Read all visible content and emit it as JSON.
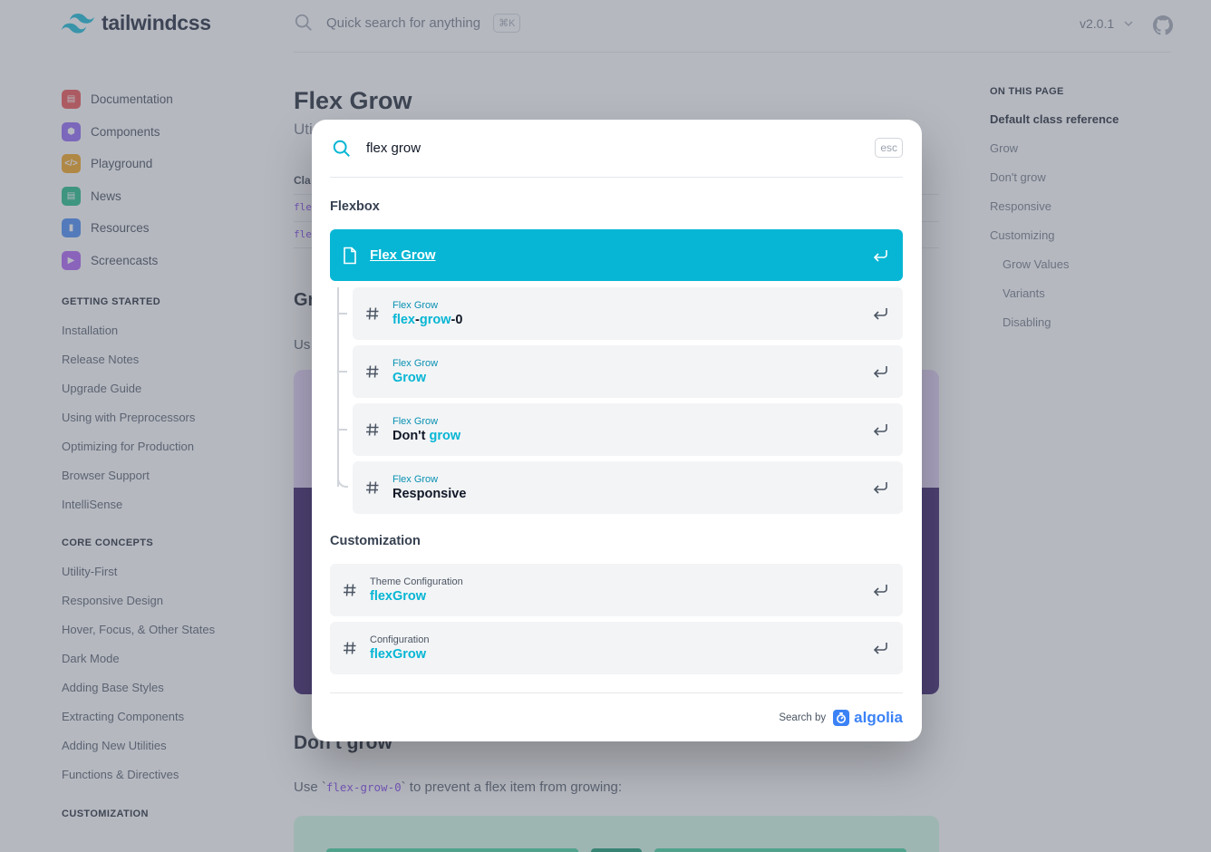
{
  "header": {
    "logo_text": "tailwindcss",
    "search_placeholder": "Quick search for anything",
    "search_shortcut": "⌘K",
    "version": "v2.0.1"
  },
  "sidebar": {
    "main_items": [
      {
        "label": "Documentation",
        "color": "#ef4444",
        "glyph": "▤"
      },
      {
        "label": "Components",
        "color": "#8b5cf6",
        "glyph": "⬢"
      },
      {
        "label": "Playground",
        "color": "#f59e0b",
        "glyph": "</>"
      },
      {
        "label": "News",
        "color": "#10b981",
        "glyph": "▤"
      },
      {
        "label": "Resources",
        "color": "#3b82f6",
        "glyph": "▮"
      },
      {
        "label": "Screencasts",
        "color": "#a855f7",
        "glyph": "▶"
      }
    ],
    "getting_started_heading": "GETTING STARTED",
    "getting_started": [
      "Installation",
      "Release Notes",
      "Upgrade Guide",
      "Using with Preprocessors",
      "Optimizing for Production",
      "Browser Support",
      "IntelliSense"
    ],
    "core_concepts_heading": "CORE CONCEPTS",
    "core_concepts": [
      "Utility-First",
      "Responsive Design",
      "Hover, Focus, & Other States",
      "Dark Mode",
      "Adding Base Styles",
      "Extracting Components",
      "Adding New Utilities",
      "Functions & Directives"
    ],
    "customization_heading": "CUSTOMIZATION"
  },
  "content": {
    "title": "Flex Grow",
    "lead": "Uti",
    "table_header": "Cla",
    "row1": "fle",
    "row2": "fle",
    "section_grow": "Gr",
    "section_grow_text": "Us",
    "section_dont_grow": "Don't grow",
    "dont_grow_text_before": "Use `",
    "dont_grow_code": "flex-grow-0",
    "dont_grow_text_after": "` to prevent a flex item from growing:"
  },
  "toc": {
    "heading": "ON THIS PAGE",
    "items": [
      {
        "label": "Default class reference",
        "active": true,
        "sub": false
      },
      {
        "label": "Grow",
        "active": false,
        "sub": false
      },
      {
        "label": "Don't grow",
        "active": false,
        "sub": false
      },
      {
        "label": "Responsive",
        "active": false,
        "sub": false
      },
      {
        "label": "Customizing",
        "active": false,
        "sub": false
      },
      {
        "label": "Grow Values",
        "active": false,
        "sub": true
      },
      {
        "label": "Variants",
        "active": false,
        "sub": true
      },
      {
        "label": "Disabling",
        "active": false,
        "sub": true
      }
    ]
  },
  "search_modal": {
    "query": "flex grow",
    "esc_label": "esc",
    "groups": [
      {
        "title": "Flexbox",
        "hits": [
          {
            "type": "page",
            "selected": true,
            "category": "",
            "title_parts": [
              {
                "t": "Flex",
                "hl": true
              },
              {
                "t": " ",
                "hl": false
              },
              {
                "t": "Grow",
                "hl": true
              }
            ]
          },
          {
            "type": "section",
            "selected": false,
            "category": "Flex Grow",
            "title_parts": [
              {
                "t": "flex",
                "hl": true
              },
              {
                "t": "-",
                "hl": false
              },
              {
                "t": "grow",
                "hl": true
              },
              {
                "t": "-0",
                "hl": false
              }
            ]
          },
          {
            "type": "section",
            "selected": false,
            "category": "Flex Grow",
            "title_parts": [
              {
                "t": "Grow",
                "hl": true
              }
            ]
          },
          {
            "type": "section",
            "selected": false,
            "category": "Flex Grow",
            "title_parts": [
              {
                "t": "Don't ",
                "hl": false
              },
              {
                "t": "grow",
                "hl": true
              }
            ]
          },
          {
            "type": "section",
            "selected": false,
            "category": "Flex Grow",
            "title_parts": [
              {
                "t": "Responsive",
                "hl": false
              }
            ]
          }
        ]
      },
      {
        "title": "Customization",
        "hits": [
          {
            "type": "section",
            "selected": false,
            "category": "Theme Configuration",
            "title_parts": [
              {
                "t": "flexGrow",
                "hl": true
              }
            ]
          },
          {
            "type": "section",
            "selected": false,
            "category": "Configuration",
            "title_parts": [
              {
                "t": "flexGrow",
                "hl": true
              }
            ]
          }
        ]
      }
    ],
    "footer_label": "Search by",
    "footer_brand": "algolia"
  },
  "colors": {
    "accent": "#06b6d4",
    "highlight_text": "#06b6d4",
    "algolia": "#3b82f6"
  }
}
